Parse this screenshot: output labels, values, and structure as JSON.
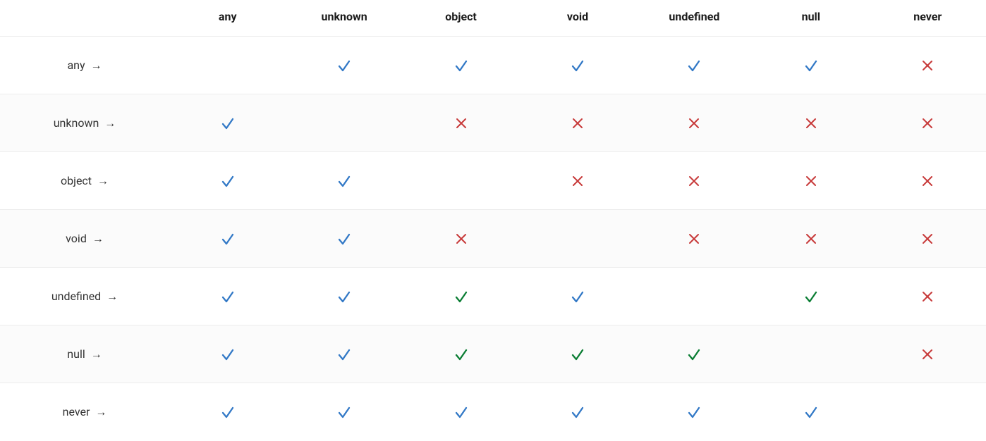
{
  "columns": [
    "any",
    "unknown",
    "object",
    "void",
    "undefined",
    "null",
    "never"
  ],
  "rows": [
    "any",
    "unknown",
    "object",
    "void",
    "undefined",
    "null",
    "never"
  ],
  "arrow": "→",
  "icons": {
    "blue": {
      "color": "#3178c6",
      "shape": "check"
    },
    "green": {
      "color": "#0a7d33",
      "shape": "check"
    },
    "red": {
      "color": "#c73939",
      "shape": "cross"
    },
    "none": {
      "color": "",
      "shape": "none"
    }
  },
  "matrix": [
    [
      "none",
      "blue",
      "blue",
      "blue",
      "blue",
      "blue",
      "red"
    ],
    [
      "blue",
      "none",
      "red",
      "red",
      "red",
      "red",
      "red"
    ],
    [
      "blue",
      "blue",
      "none",
      "red",
      "red",
      "red",
      "red"
    ],
    [
      "blue",
      "blue",
      "red",
      "none",
      "red",
      "red",
      "red"
    ],
    [
      "blue",
      "blue",
      "green",
      "blue",
      "none",
      "green",
      "red"
    ],
    [
      "blue",
      "blue",
      "green",
      "green",
      "green",
      "none",
      "red"
    ],
    [
      "blue",
      "blue",
      "blue",
      "blue",
      "blue",
      "blue",
      "none"
    ]
  ]
}
